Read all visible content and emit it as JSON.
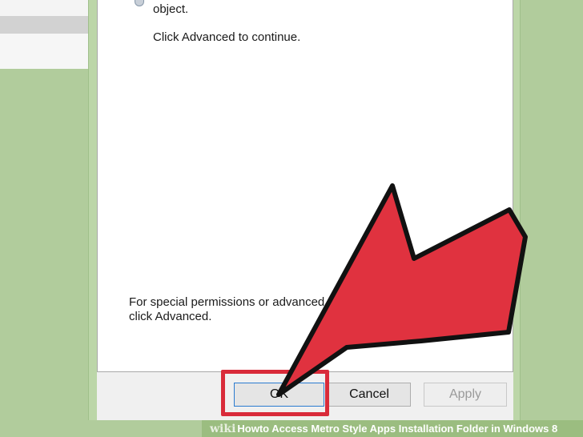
{
  "dialog": {
    "line_object": "object.",
    "line_continue": "Click Advanced to continue.",
    "special_line1": "For special permissions or advanced s",
    "special_line2": "click Advanced."
  },
  "buttons": {
    "ok": "OK",
    "cancel": "Cancel",
    "apply": "Apply"
  },
  "caption": {
    "brand": "wiki",
    "how": "How",
    "title": " to Access Metro Style Apps Installation Folder in Windows 8"
  },
  "colors": {
    "arrow": "#e0323f",
    "highlight": "#d92b3a",
    "background": "#b1cc9c"
  }
}
